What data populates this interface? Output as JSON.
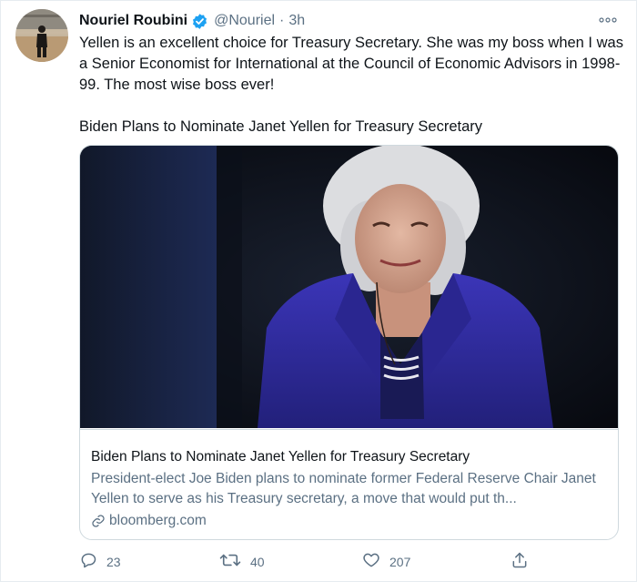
{
  "author": {
    "display_name": "Nouriel Roubini",
    "handle": "@Nouriel",
    "separator": "·",
    "timestamp": "3h",
    "verified": true
  },
  "tweet": {
    "text": "Yellen is an excellent choice for Treasury Secretary. She was my boss when I was a Senior Economist for International at the Council of Economic Advisors in 1998-99. The most wise boss ever!",
    "link_title": "Biden Plans to Nominate Janet Yellen for Treasury Secretary"
  },
  "card": {
    "title": "Biden Plans to Nominate Janet Yellen for Treasury Secretary",
    "description": "President-elect Joe Biden plans to nominate former Federal Reserve Chair Janet Yellen to serve as his Treasury secretary, a move that would put th...",
    "domain": "bloomberg.com"
  },
  "actions": {
    "replies": "23",
    "retweets": "40",
    "likes": "207"
  },
  "icons": {
    "verified": "verified-badge-icon",
    "more": "more-icon",
    "link": "link-icon",
    "reply": "reply-icon",
    "retweet": "retweet-icon",
    "like": "heart-icon",
    "share": "share-icon"
  },
  "colors": {
    "accent": "#1da1f2",
    "secondary_text": "#5b7083",
    "primary_text": "#0f1419",
    "border": "#cfd9de"
  }
}
